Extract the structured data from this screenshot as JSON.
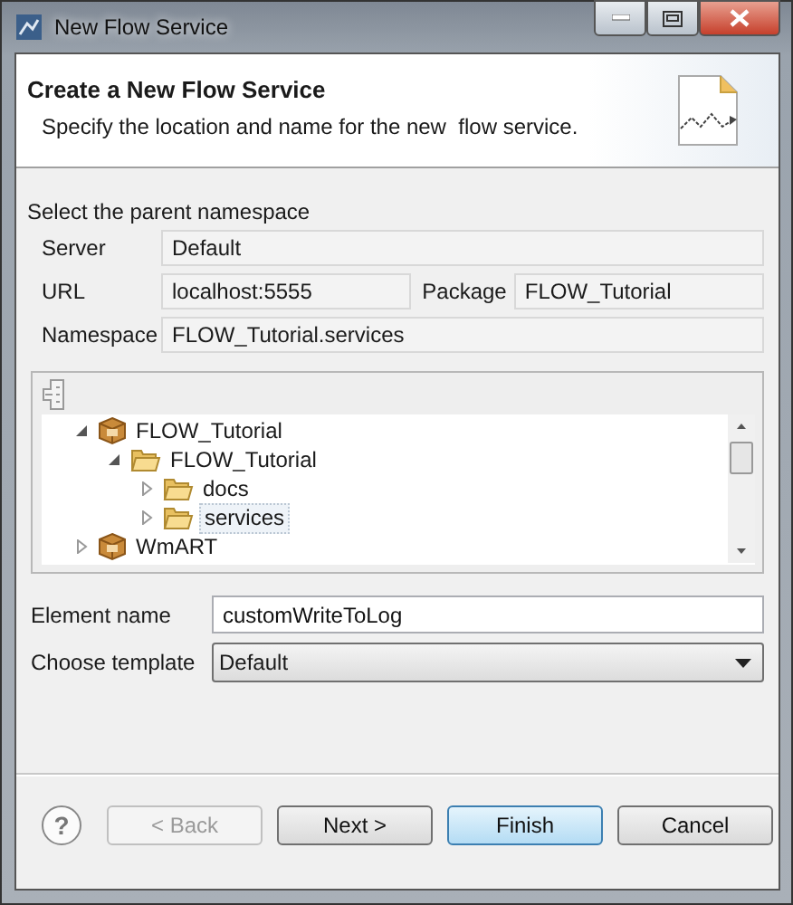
{
  "window": {
    "title": "New Flow Service"
  },
  "header": {
    "title": "Create a New Flow Service",
    "description": "Specify the location and name for the new  flow service."
  },
  "namespace": {
    "label": "Select the parent namespace",
    "rows": [
      {
        "fields": [
          {
            "label": "Server",
            "value": "Default"
          }
        ]
      },
      {
        "fields": [
          {
            "label": "URL",
            "value": "localhost:5555"
          },
          {
            "label": "Package",
            "value": "FLOW_Tutorial"
          }
        ]
      },
      {
        "fields": [
          {
            "label": "Namespace",
            "value": "FLOW_Tutorial.services"
          }
        ]
      }
    ]
  },
  "tree": {
    "items": [
      {
        "label": "FLOW_Tutorial",
        "kind": "package",
        "expanded": true,
        "selected": false,
        "children": [
          {
            "label": "FLOW_Tutorial",
            "kind": "folder",
            "expanded": true,
            "selected": false,
            "children": [
              {
                "label": "docs",
                "kind": "folder",
                "expanded": false,
                "selected": false
              },
              {
                "label": "services",
                "kind": "folder",
                "expanded": false,
                "selected": true
              }
            ]
          }
        ]
      },
      {
        "label": "WmART",
        "kind": "package",
        "expanded": false,
        "selected": false
      }
    ]
  },
  "element_name": {
    "label": "Element name",
    "value": "customWriteToLog"
  },
  "template": {
    "label": "Choose template",
    "value": "Default"
  },
  "help": {
    "label": "?"
  },
  "buttons": [
    {
      "label": "< Back",
      "disabled": true,
      "default": false
    },
    {
      "label": "Next >",
      "disabled": false,
      "default": false
    },
    {
      "label": "Finish",
      "disabled": false,
      "default": true
    },
    {
      "label": "Cancel",
      "disabled": false,
      "default": false
    }
  ]
}
